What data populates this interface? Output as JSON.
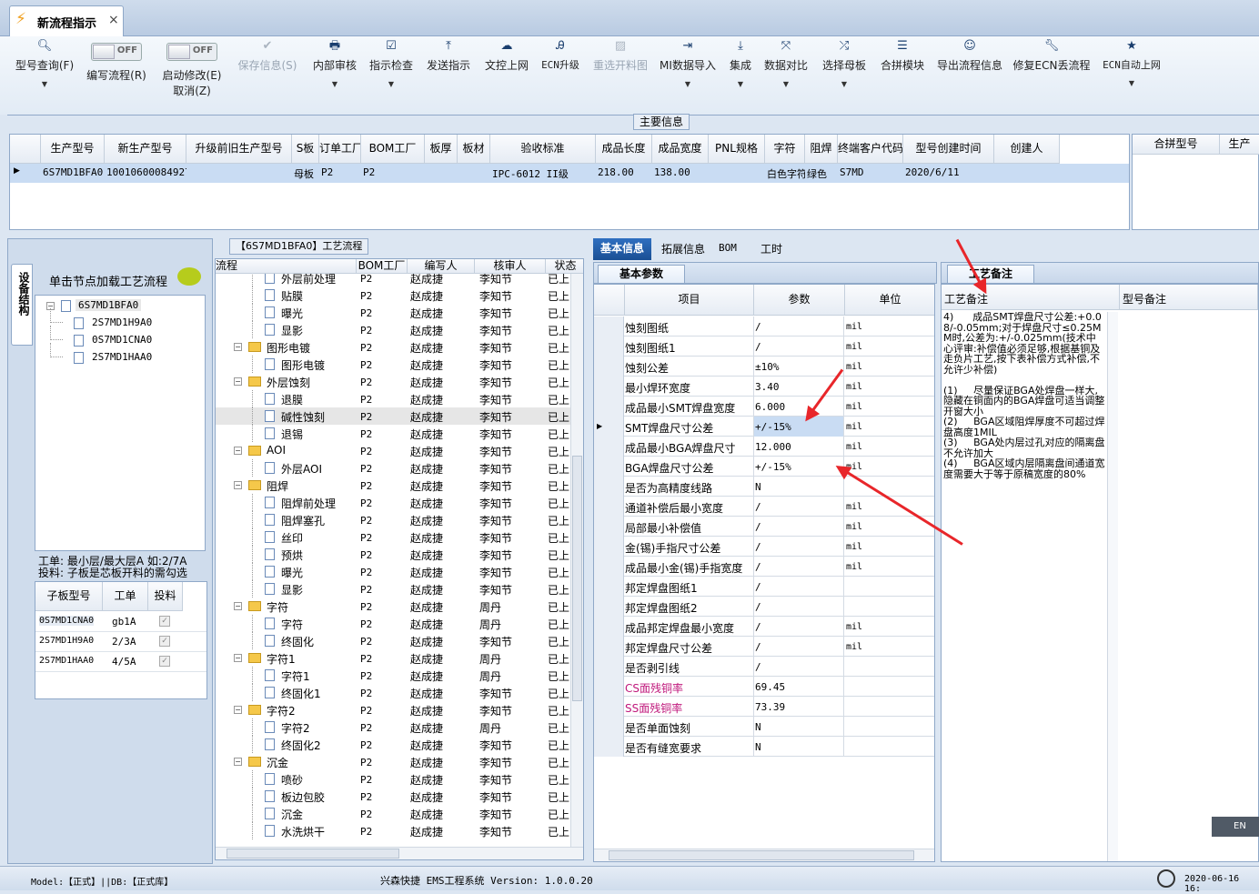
{
  "window": {
    "tab_title": "新流程指示",
    "tab_close": "×"
  },
  "toolbar": {
    "model_query": "型号查询(F)",
    "edit_flow": "编写流程(R)",
    "edit_toggle": "OFF",
    "start_modify": "启动修改(E)",
    "start_toggle": "OFF",
    "cancel": "取消(Z)",
    "save": "保存信息(S)",
    "internal_review": "内部审核",
    "instruction_check": "指示检查",
    "send": "发送指示",
    "upload": "文控上网",
    "ecn_upgrade": "ECN升级",
    "reselect_panel": "重选开料图",
    "mi_import": "MI数据导入",
    "integrate": "集成",
    "compare": "数据对比",
    "select_mother": "选择母板",
    "merge_module": "合拼模块",
    "export_flow": "导出流程信息",
    "fix_ecn": "修复ECN丢流程",
    "ecn_auto": "ECN自动上网"
  },
  "main_info": {
    "group_title": "主要信息",
    "columns": [
      "生产型号",
      "新生产型号",
      "升级前旧生产型号",
      "S板",
      "订单工厂",
      "BOM工厂",
      "板厚",
      "板材",
      "验收标准",
      "成品长度",
      "成品宽度",
      "PNL规格",
      "字符",
      "阻焊",
      "终端客户代码",
      "型号创建时间",
      "创建人"
    ],
    "row": [
      "6S7MD1BFA0",
      "10010600084927",
      "",
      "母板",
      "P2",
      "P2",
      "",
      "",
      "IPC-6012 II级",
      "218.00",
      "138.00",
      "",
      "白色字符",
      "绿色",
      "S7MD",
      "2020/6/11",
      ""
    ],
    "side_columns": [
      "合拼型号",
      "生产"
    ]
  },
  "left_panel": {
    "vertical_tab": "设备结构",
    "hint": "单击节点加载工艺流程",
    "tree": {
      "root": "6S7MD1BFA0",
      "children": [
        "2S7MD1H9A0",
        "0S7MD1CNA0",
        "2S7MD1HAA0"
      ]
    },
    "note_line1": "工单: 最小层/最大层A 如:2/7A",
    "note_line2": "投料: 子板是芯板开料的需勾选",
    "sub_table": {
      "columns": [
        "子板型号",
        "工单",
        "投料"
      ],
      "rows": [
        [
          "0S7MD1CNA0",
          "gb1A"
        ],
        [
          "2S7MD1H9A0",
          "2/3A"
        ],
        [
          "2S7MD1HAA0",
          "4/5A"
        ]
      ]
    }
  },
  "flow_panel": {
    "title": "【6S7MD1BFA0】工艺流程",
    "columns": [
      "流程",
      "BOM工厂",
      "编写人",
      "核审人",
      "状态"
    ],
    "rows": [
      {
        "indent": 2,
        "icon": "doc",
        "name": "外层前处理",
        "bom": "P2",
        "writer": "赵成捷",
        "reviewer": "李知节",
        "status": "已上"
      },
      {
        "indent": 2,
        "icon": "doc",
        "name": "贴膜",
        "bom": "P2",
        "writer": "赵成捷",
        "reviewer": "李知节",
        "status": "已上"
      },
      {
        "indent": 2,
        "icon": "doc",
        "name": "曝光",
        "bom": "P2",
        "writer": "赵成捷",
        "reviewer": "李知节",
        "status": "已上"
      },
      {
        "indent": 2,
        "icon": "doc",
        "name": "显影",
        "bom": "P2",
        "writer": "赵成捷",
        "reviewer": "李知节",
        "status": "已上"
      },
      {
        "indent": 1,
        "icon": "folder",
        "name": "图形电镀",
        "bom": "P2",
        "writer": "赵成捷",
        "reviewer": "李知节",
        "status": "已上"
      },
      {
        "indent": 2,
        "icon": "doc",
        "name": "图形电镀",
        "bom": "P2",
        "writer": "赵成捷",
        "reviewer": "李知节",
        "status": "已上"
      },
      {
        "indent": 1,
        "icon": "folder",
        "name": "外层蚀刻",
        "bom": "P2",
        "writer": "赵成捷",
        "reviewer": "李知节",
        "status": "已上"
      },
      {
        "indent": 2,
        "icon": "doc",
        "name": "退膜",
        "bom": "P2",
        "writer": "赵成捷",
        "reviewer": "李知节",
        "status": "已上"
      },
      {
        "indent": 2,
        "icon": "doc",
        "name": "碱性蚀刻",
        "bom": "P2",
        "writer": "赵成捷",
        "reviewer": "李知节",
        "status": "已上",
        "selected": true
      },
      {
        "indent": 2,
        "icon": "doc",
        "name": "退锡",
        "bom": "P2",
        "writer": "赵成捷",
        "reviewer": "李知节",
        "status": "已上"
      },
      {
        "indent": 1,
        "icon": "folder",
        "name": "AOI",
        "bom": "P2",
        "writer": "赵成捷",
        "reviewer": "李知节",
        "status": "已上"
      },
      {
        "indent": 2,
        "icon": "doc",
        "name": "外层AOI",
        "bom": "P2",
        "writer": "赵成捷",
        "reviewer": "李知节",
        "status": "已上"
      },
      {
        "indent": 1,
        "icon": "folder",
        "name": "阻焊",
        "bom": "P2",
        "writer": "赵成捷",
        "reviewer": "李知节",
        "status": "已上"
      },
      {
        "indent": 2,
        "icon": "doc",
        "name": "阻焊前处理",
        "bom": "P2",
        "writer": "赵成捷",
        "reviewer": "李知节",
        "status": "已上"
      },
      {
        "indent": 2,
        "icon": "doc",
        "name": "阻焊塞孔",
        "bom": "P2",
        "writer": "赵成捷",
        "reviewer": "李知节",
        "status": "已上"
      },
      {
        "indent": 2,
        "icon": "doc",
        "name": "丝印",
        "bom": "P2",
        "writer": "赵成捷",
        "reviewer": "李知节",
        "status": "已上"
      },
      {
        "indent": 2,
        "icon": "doc",
        "name": "预烘",
        "bom": "P2",
        "writer": "赵成捷",
        "reviewer": "李知节",
        "status": "已上"
      },
      {
        "indent": 2,
        "icon": "doc",
        "name": "曝光",
        "bom": "P2",
        "writer": "赵成捷",
        "reviewer": "李知节",
        "status": "已上"
      },
      {
        "indent": 2,
        "icon": "doc",
        "name": "显影",
        "bom": "P2",
        "writer": "赵成捷",
        "reviewer": "李知节",
        "status": "已上"
      },
      {
        "indent": 1,
        "icon": "folder",
        "name": "字符",
        "bom": "P2",
        "writer": "赵成捷",
        "reviewer": "周丹",
        "status": "已上"
      },
      {
        "indent": 2,
        "icon": "doc",
        "name": "字符",
        "bom": "P2",
        "writer": "赵成捷",
        "reviewer": "周丹",
        "status": "已上"
      },
      {
        "indent": 2,
        "icon": "doc",
        "name": "终固化",
        "bom": "P2",
        "writer": "赵成捷",
        "reviewer": "李知节",
        "status": "已上"
      },
      {
        "indent": 1,
        "icon": "folder",
        "name": "字符1",
        "bom": "P2",
        "writer": "赵成捷",
        "reviewer": "周丹",
        "status": "已上"
      },
      {
        "indent": 2,
        "icon": "doc",
        "name": "字符1",
        "bom": "P2",
        "writer": "赵成捷",
        "reviewer": "周丹",
        "status": "已上"
      },
      {
        "indent": 2,
        "icon": "doc",
        "name": "终固化1",
        "bom": "P2",
        "writer": "赵成捷",
        "reviewer": "李知节",
        "status": "已上"
      },
      {
        "indent": 1,
        "icon": "folder",
        "name": "字符2",
        "bom": "P2",
        "writer": "赵成捷",
        "reviewer": "李知节",
        "status": "已上"
      },
      {
        "indent": 2,
        "icon": "doc",
        "name": "字符2",
        "bom": "P2",
        "writer": "赵成捷",
        "reviewer": "周丹",
        "status": "已上"
      },
      {
        "indent": 2,
        "icon": "doc",
        "name": "终固化2",
        "bom": "P2",
        "writer": "赵成捷",
        "reviewer": "李知节",
        "status": "已上"
      },
      {
        "indent": 1,
        "icon": "folder",
        "name": "沉金",
        "bom": "P2",
        "writer": "赵成捷",
        "reviewer": "李知节",
        "status": "已上"
      },
      {
        "indent": 2,
        "icon": "doc",
        "name": "喷砂",
        "bom": "P2",
        "writer": "赵成捷",
        "reviewer": "李知节",
        "status": "已上"
      },
      {
        "indent": 2,
        "icon": "doc",
        "name": "板边包胶",
        "bom": "P2",
        "writer": "赵成捷",
        "reviewer": "李知节",
        "status": "已上"
      },
      {
        "indent": 2,
        "icon": "doc",
        "name": "沉金",
        "bom": "P2",
        "writer": "赵成捷",
        "reviewer": "李知节",
        "status": "已上"
      },
      {
        "indent": 2,
        "icon": "doc",
        "name": "水洗烘干",
        "bom": "P2",
        "writer": "赵成捷",
        "reviewer": "李知节",
        "status": "已上"
      }
    ]
  },
  "detail_tabs": [
    "基本信息",
    "拓展信息",
    "BOM",
    "工时"
  ],
  "basic_params": {
    "title": "基本参数",
    "columns": [
      "项目",
      "参数",
      "单位"
    ],
    "rows": [
      {
        "item": "蚀刻图纸",
        "value": "/",
        "unit": "mil"
      },
      {
        "item": "蚀刻图纸1",
        "value": "/",
        "unit": "mil"
      },
      {
        "item": "蚀刻公差",
        "value": "±10%",
        "unit": "mil"
      },
      {
        "item": "最小焊环宽度",
        "value": "3.40",
        "unit": "mil"
      },
      {
        "item": "成品最小SMT焊盘宽度",
        "value": "6.000",
        "unit": "mil"
      },
      {
        "item": "SMT焊盘尺寸公差",
        "value": "+/-15%",
        "unit": "mil",
        "current": true
      },
      {
        "item": "成品最小BGA焊盘尺寸",
        "value": "12.000",
        "unit": "mil"
      },
      {
        "item": "BGA焊盘尺寸公差",
        "value": "+/-15%",
        "unit": "mil"
      },
      {
        "item": "是否为高精度线路",
        "value": "N",
        "unit": ""
      },
      {
        "item": "通道补偿后最小宽度",
        "value": "/",
        "unit": "mil"
      },
      {
        "item": "局部最小补偿值",
        "value": "/",
        "unit": "mil"
      },
      {
        "item": "金(锡)手指尺寸公差",
        "value": "/",
        "unit": "mil"
      },
      {
        "item": "成品最小金(锡)手指宽度",
        "value": "/",
        "unit": "mil"
      },
      {
        "item": "邦定焊盘图纸1",
        "value": "/",
        "unit": ""
      },
      {
        "item": "邦定焊盘图纸2",
        "value": "/",
        "unit": ""
      },
      {
        "item": "成品邦定焊盘最小宽度",
        "value": "/",
        "unit": "mil"
      },
      {
        "item": "邦定焊盘尺寸公差",
        "value": "/",
        "unit": "mil"
      },
      {
        "item": "是否剥引线",
        "value": "/",
        "unit": ""
      },
      {
        "item": "CS面残铜率",
        "value": "69.45",
        "unit": "",
        "pink": true
      },
      {
        "item": "SS面残铜率",
        "value": "73.39",
        "unit": "",
        "pink": true
      },
      {
        "item": "是否单面蚀刻",
        "value": "N",
        "unit": ""
      },
      {
        "item": "是否有缝宽要求",
        "value": "N",
        "unit": ""
      }
    ]
  },
  "remarks": {
    "title": "工艺备注",
    "col_process": "工艺备注",
    "col_model": "型号备注",
    "text": "4)      成品SMT焊盘尺寸公差:+0.08/-0.05mm;对于焊盘尺寸≤0.25MM时,公差为:+/-0.025mm(技术中心评审:补偿值必须足够,根据基铜及走负片工艺,按下表补偿方式补偿,不允许少补偿)\n\n(1)     尽量保证BGA处焊盘一样大,隐藏在铜面内的BGA焊盘可适当调整开窗大小\n(2)     BGA区域阻焊厚度不可超过焊盘高度1MIL\n(3)     BGA处内层过孔对应的隔离盘不允许加大\n(4)     BGA区域内层隔离盘间通道宽度需要大于等于原稿宽度的80%"
  },
  "ime": "EN",
  "status_bar": {
    "left": "Model:【正式】||DB:【正式库】",
    "center": "兴森快捷 EMS工程系统 Version: 1.0.0.20",
    "right": "2020-06-16 16:"
  },
  "colors": {
    "accent": "#1f5fa8",
    "selection": "#c9dcf3",
    "pink": "#c0197c",
    "arrow": "#e8262a"
  }
}
